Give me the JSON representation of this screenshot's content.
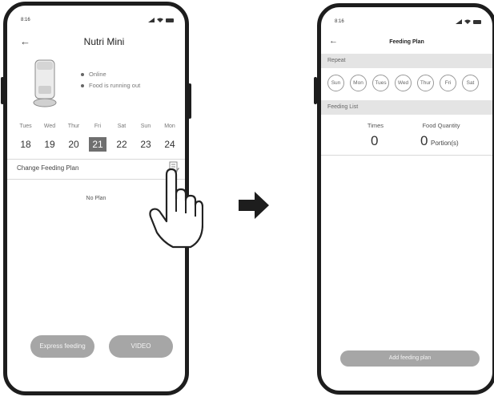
{
  "phone1": {
    "status_time": "8:16",
    "back_glyph": "←",
    "title": "Nutri Mini",
    "status_online": "Online",
    "status_food": "Food is running out",
    "days": [
      "Tues",
      "Wed",
      "Thur",
      "Fri",
      "Sat",
      "Sun",
      "Mon"
    ],
    "dates": [
      "18",
      "19",
      "20",
      "21",
      "22",
      "23",
      "24"
    ],
    "selected_date_index": 3,
    "change_plan_label": "Change Feeding Plan",
    "no_plan": "No Plan",
    "express_feeding_label": "Express feeding",
    "video_label": "VIDEO"
  },
  "phone2": {
    "status_time": "8:16",
    "back_glyph": "←",
    "title": "Feeding Plan",
    "repeat_label": "Repeat",
    "weekdays": [
      "Sun",
      "Mon",
      "Tues",
      "Wed",
      "Thur",
      "Fri",
      "Sat"
    ],
    "feeding_list_label": "Feeding List",
    "times_label": "Times",
    "food_quantity_label": "Food Quantity",
    "times_value": "0",
    "quantity_value": "0",
    "portion_unit": "Portion(s)",
    "add_plan_label": "Add feeding plan"
  },
  "icons": [
    "hand-pointer-icon",
    "arrow-right-icon",
    "edit-plan-icon",
    "feeder-device-image",
    "wifi-icon",
    "signal-icon",
    "battery-icon"
  ],
  "colors": {
    "selected_date": "#6f6f6f",
    "button_gray": "#a6a6a6",
    "band_gray": "#e4e4e4",
    "frame": "#1d1d1d"
  }
}
